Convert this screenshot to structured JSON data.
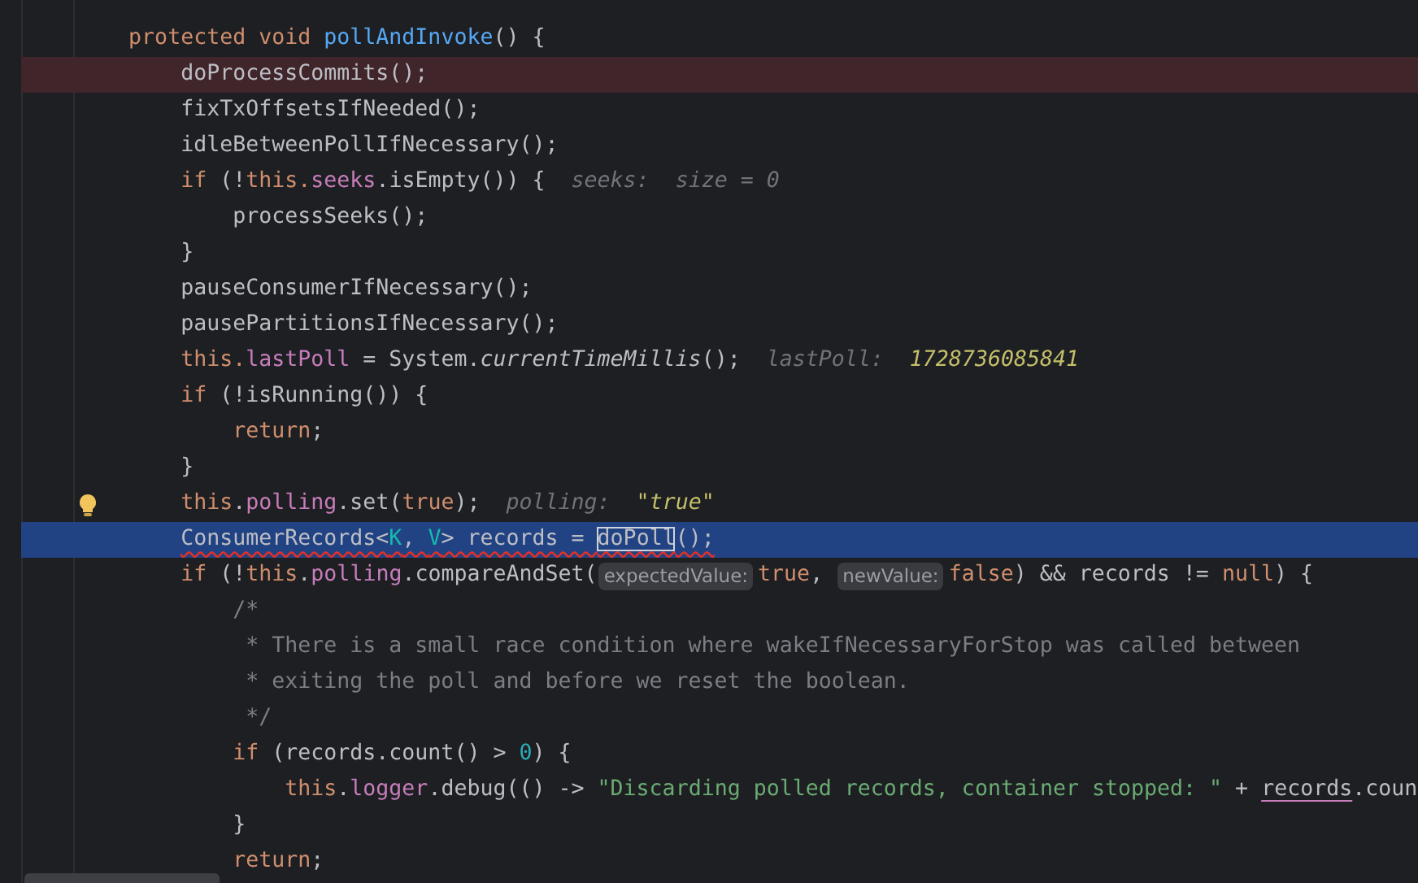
{
  "editor": {
    "lines": [
      {
        "breakpoint": false,
        "current": false,
        "tokens": [
          {
            "kind": "kw",
            "text": "        protected void "
          },
          {
            "kind": "decl",
            "text": "pollAndInvoke"
          },
          {
            "kind": "plain",
            "text": "() {"
          }
        ]
      },
      {
        "breakpoint": true,
        "current": false,
        "tokens": [
          {
            "kind": "plain",
            "text": "            doProcessCommits();"
          }
        ]
      },
      {
        "breakpoint": false,
        "current": false,
        "tokens": [
          {
            "kind": "plain",
            "text": "            fixTxOffsetsIfNeeded();"
          }
        ]
      },
      {
        "breakpoint": false,
        "current": false,
        "tokens": [
          {
            "kind": "plain",
            "text": "            idleBetweenPollIfNecessary();"
          }
        ]
      },
      {
        "breakpoint": false,
        "current": false,
        "tokens": [
          {
            "kind": "kw",
            "text": "            if"
          },
          {
            "kind": "plain",
            "text": " (!"
          },
          {
            "kind": "kw",
            "text": "this."
          },
          {
            "kind": "field",
            "text": "seeks"
          },
          {
            "kind": "plain",
            "text": ".isEmpty()) {"
          },
          {
            "kind": "hint",
            "label": "seeks:",
            "value": "size = 0",
            "literal": false
          }
        ]
      },
      {
        "breakpoint": false,
        "current": false,
        "tokens": [
          {
            "kind": "plain",
            "text": "                processSeeks();"
          }
        ]
      },
      {
        "breakpoint": false,
        "current": false,
        "tokens": [
          {
            "kind": "plain",
            "text": "            }"
          }
        ]
      },
      {
        "breakpoint": false,
        "current": false,
        "tokens": [
          {
            "kind": "plain",
            "text": "            pauseConsumerIfNecessary();"
          }
        ]
      },
      {
        "breakpoint": false,
        "current": false,
        "tokens": [
          {
            "kind": "plain",
            "text": "            pausePartitionsIfNecessary();"
          }
        ]
      },
      {
        "breakpoint": false,
        "current": false,
        "tokens": [
          {
            "kind": "kw",
            "text": "            this."
          },
          {
            "kind": "field",
            "text": "lastPoll"
          },
          {
            "kind": "plain",
            "text": " = System."
          },
          {
            "kind": "static",
            "text": "currentTimeMillis"
          },
          {
            "kind": "plain",
            "text": "();"
          },
          {
            "kind": "hint",
            "label": "lastPoll:",
            "value": "1728736085841",
            "literal": true
          }
        ]
      },
      {
        "breakpoint": false,
        "current": false,
        "tokens": [
          {
            "kind": "kw",
            "text": "            if"
          },
          {
            "kind": "plain",
            "text": " (!isRunning()) {"
          }
        ]
      },
      {
        "breakpoint": false,
        "current": false,
        "tokens": [
          {
            "kind": "kw",
            "text": "                return"
          },
          {
            "kind": "plain",
            "text": ";"
          }
        ]
      },
      {
        "breakpoint": false,
        "current": false,
        "tokens": [
          {
            "kind": "plain",
            "text": "            }"
          }
        ]
      },
      {
        "breakpoint": false,
        "current": false,
        "bulb": true,
        "tokens": [
          {
            "kind": "kw",
            "text": "            this"
          },
          {
            "kind": "plain",
            "text": "."
          },
          {
            "kind": "field",
            "text": "polling"
          },
          {
            "kind": "plain",
            "text": ".set("
          },
          {
            "kind": "kw",
            "text": "true"
          },
          {
            "kind": "plain",
            "text": ");"
          },
          {
            "kind": "hint",
            "label": "polling:",
            "value": "\"true\"",
            "literal": true
          }
        ]
      },
      {
        "breakpoint": false,
        "current": true,
        "error_underline": true,
        "tokens": [
          {
            "kind": "plain",
            "text": "            ConsumerRecords<"
          },
          {
            "kind": "typeparam",
            "text": "K"
          },
          {
            "kind": "plain",
            "text": ", "
          },
          {
            "kind": "typeparam",
            "text": "V"
          },
          {
            "kind": "plain",
            "text": "> records = "
          },
          {
            "kind": "boxed",
            "text": "doPoll"
          },
          {
            "kind": "plain",
            "text": "();"
          }
        ]
      },
      {
        "breakpoint": false,
        "current": false,
        "tokens": [
          {
            "kind": "kw",
            "text": "            if"
          },
          {
            "kind": "plain",
            "text": " (!"
          },
          {
            "kind": "kw",
            "text": "this"
          },
          {
            "kind": "plain",
            "text": "."
          },
          {
            "kind": "field",
            "text": "polling"
          },
          {
            "kind": "plain",
            "text": ".compareAndSet("
          },
          {
            "kind": "param",
            "text": "expectedValue:"
          },
          {
            "kind": "kw",
            "text": "true"
          },
          {
            "kind": "plain",
            "text": ", "
          },
          {
            "kind": "param",
            "text": "newValue:"
          },
          {
            "kind": "kw",
            "text": "false"
          },
          {
            "kind": "plain",
            "text": ") && records != "
          },
          {
            "kind": "kw",
            "text": "null"
          },
          {
            "kind": "plain",
            "text": ") {"
          }
        ]
      },
      {
        "breakpoint": false,
        "current": false,
        "tokens": [
          {
            "kind": "comment",
            "text": "                /*"
          }
        ]
      },
      {
        "breakpoint": false,
        "current": false,
        "tokens": [
          {
            "kind": "comment",
            "text": "                 * There is a small race condition where wakeIfNecessaryForStop was called between"
          }
        ]
      },
      {
        "breakpoint": false,
        "current": false,
        "tokens": [
          {
            "kind": "comment",
            "text": "                 * exiting the poll and before we reset the boolean."
          }
        ]
      },
      {
        "breakpoint": false,
        "current": false,
        "tokens": [
          {
            "kind": "comment",
            "text": "                 */"
          }
        ]
      },
      {
        "breakpoint": false,
        "current": false,
        "tokens": [
          {
            "kind": "kw",
            "text": "                if"
          },
          {
            "kind": "plain",
            "text": " (records.count() > "
          },
          {
            "kind": "number",
            "text": "0"
          },
          {
            "kind": "plain",
            "text": ") {"
          }
        ]
      },
      {
        "breakpoint": false,
        "current": false,
        "tokens": [
          {
            "kind": "kw",
            "text": "                    this"
          },
          {
            "kind": "plain",
            "text": "."
          },
          {
            "kind": "field",
            "text": "logger"
          },
          {
            "kind": "plain",
            "text": ".debug(() -> "
          },
          {
            "kind": "string",
            "text": "\"Discarding polled records, container stopped: \""
          },
          {
            "kind": "plain",
            "text": " + "
          },
          {
            "kind": "ref",
            "text": "records"
          },
          {
            "kind": "plain",
            "text": ".coun"
          }
        ]
      },
      {
        "breakpoint": false,
        "current": false,
        "tokens": [
          {
            "kind": "plain",
            "text": "                }"
          }
        ]
      },
      {
        "breakpoint": false,
        "current": false,
        "tokens": [
          {
            "kind": "kw",
            "text": "                return"
          },
          {
            "kind": "plain",
            "text": ";"
          }
        ]
      }
    ]
  }
}
